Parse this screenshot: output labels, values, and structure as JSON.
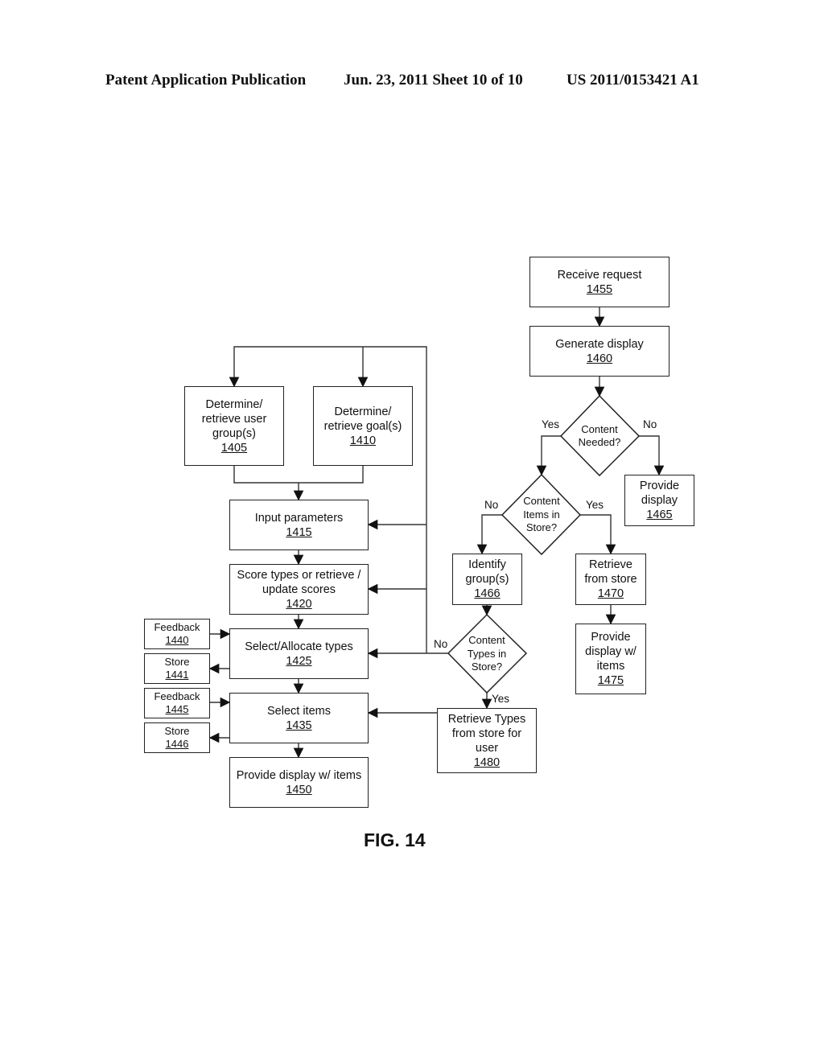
{
  "header": {
    "publication": "Patent Application Publication",
    "date_sheet": "Jun. 23, 2011  Sheet 10 of 10",
    "pub_number": "US 2011/0153421 A1"
  },
  "figure_label": "FIG. 14",
  "boxes": {
    "b1405": {
      "text": [
        "Determine/",
        "retrieve user",
        "group(s)"
      ],
      "num": "1405"
    },
    "b1410": {
      "text": [
        "Determine/",
        "retrieve goal(s)"
      ],
      "num": "1410"
    },
    "b1415": {
      "text": [
        "Input parameters"
      ],
      "num": "1415"
    },
    "b1420": {
      "text": [
        "Score types or retrieve /",
        "update scores"
      ],
      "num": "1420"
    },
    "b1425": {
      "text": [
        "Select/Allocate types"
      ],
      "num": "1425"
    },
    "b1435": {
      "text": [
        "Select items"
      ],
      "num": "1435"
    },
    "b1450": {
      "text": [
        "Provide display w/ items"
      ],
      "num": "1450"
    },
    "b1440": {
      "text": [
        "Feedback"
      ],
      "num": "1440"
    },
    "b1441": {
      "text": [
        "Store"
      ],
      "num": "1441"
    },
    "b1445": {
      "text": [
        "Feedback"
      ],
      "num": "1445"
    },
    "b1446": {
      "text": [
        "Store"
      ],
      "num": "1446"
    },
    "b1455": {
      "text": [
        "Receive request"
      ],
      "num": "1455"
    },
    "b1460": {
      "text": [
        "Generate display"
      ],
      "num": "1460"
    },
    "b1465": {
      "text": [
        "Provide",
        "display"
      ],
      "num": "1465"
    },
    "b1466": {
      "text": [
        "Identify",
        "group(s)"
      ],
      "num": "1466"
    },
    "b1470": {
      "text": [
        "Retrieve",
        "from store"
      ],
      "num": "1470"
    },
    "b1475": {
      "text": [
        "Provide",
        "display w/",
        "items"
      ],
      "num": "1475"
    },
    "b1480": {
      "text": [
        "Retrieve Types",
        "from store for",
        "user"
      ],
      "num": "1480"
    }
  },
  "decisions": {
    "content_needed": {
      "text": [
        "Content",
        "Needed?"
      ],
      "yes": "Yes",
      "no": "No"
    },
    "items_in_store": {
      "text": [
        "Content",
        "Items in",
        "Store?"
      ],
      "yes": "Yes",
      "no": "No"
    },
    "types_in_store": {
      "text": [
        "Content",
        "Types in",
        "Store?"
      ],
      "yes": "Yes",
      "no": "No"
    }
  }
}
